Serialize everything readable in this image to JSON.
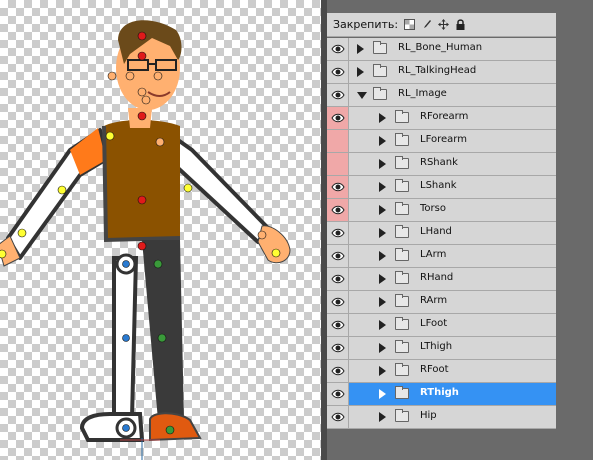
{
  "lock_bar": {
    "label": "Закрепить:",
    "icons": [
      "transparency-lock-icon",
      "brush-lock-icon",
      "move-lock-icon",
      "padlock-icon"
    ]
  },
  "layers": [
    {
      "name": "RL_Bone_Human",
      "visible": true,
      "eye_bg": "normal",
      "level": 0,
      "expanded": false
    },
    {
      "name": "RL_TalkingHead",
      "visible": true,
      "eye_bg": "normal",
      "level": 0,
      "expanded": false
    },
    {
      "name": "RL_Image",
      "visible": true,
      "eye_bg": "normal",
      "level": 0,
      "expanded": true
    },
    {
      "name": "RForearm",
      "visible": true,
      "eye_bg": "red",
      "level": 1,
      "expanded": false
    },
    {
      "name": "LForearm",
      "visible": false,
      "eye_bg": "red",
      "level": 1,
      "expanded": false
    },
    {
      "name": "RShank",
      "visible": false,
      "eye_bg": "red",
      "level": 1,
      "expanded": false
    },
    {
      "name": "LShank",
      "visible": true,
      "eye_bg": "red",
      "level": 1,
      "expanded": false
    },
    {
      "name": "Torso",
      "visible": true,
      "eye_bg": "red",
      "level": 1,
      "expanded": false
    },
    {
      "name": "LHand",
      "visible": true,
      "eye_bg": "normal",
      "level": 1,
      "expanded": false
    },
    {
      "name": "LArm",
      "visible": true,
      "eye_bg": "normal",
      "level": 1,
      "expanded": false
    },
    {
      "name": "RHand",
      "visible": true,
      "eye_bg": "normal",
      "level": 1,
      "expanded": false
    },
    {
      "name": "RArm",
      "visible": true,
      "eye_bg": "normal",
      "level": 1,
      "expanded": false
    },
    {
      "name": "LFoot",
      "visible": true,
      "eye_bg": "normal",
      "level": 1,
      "expanded": false
    },
    {
      "name": "LThigh",
      "visible": true,
      "eye_bg": "normal",
      "level": 1,
      "expanded": false
    },
    {
      "name": "RFoot",
      "visible": true,
      "eye_bg": "normal",
      "level": 1,
      "expanded": false
    },
    {
      "name": "RThigh",
      "visible": true,
      "eye_bg": "normal",
      "level": 1,
      "expanded": false,
      "selected": true
    },
    {
      "name": "Hip",
      "visible": true,
      "eye_bg": "normal",
      "level": 1,
      "expanded": false
    }
  ],
  "colors": {
    "selection": "#3592f3",
    "eye_highlight": "#f0a8a8",
    "panel_bg": "#d6d6d6"
  }
}
